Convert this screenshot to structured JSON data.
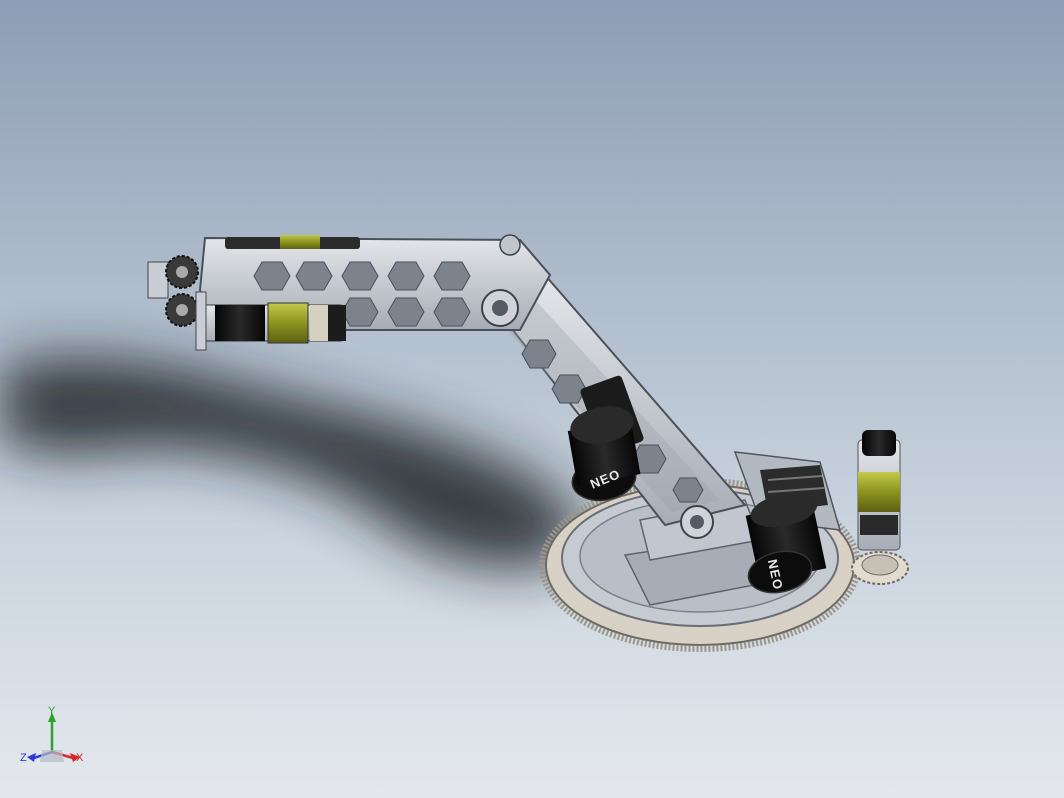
{
  "viewport": {
    "background_top": "#8d9eb6",
    "background_bottom": "#e4e8ed"
  },
  "model": {
    "motor_labels": [
      "NEO",
      "NEO"
    ],
    "colors": {
      "aluminum": "#c9ced6",
      "aluminum_dark": "#8a9099",
      "motor_black": "#141414",
      "gearbox_yellow": "#9aa12a",
      "gear_white": "#ece6da"
    }
  },
  "triad": {
    "x_label": "X",
    "y_label": "Y",
    "z_label": "Z",
    "x_color": "#d42a2a",
    "y_color": "#2aa52a",
    "z_color": "#2a3ad4"
  }
}
